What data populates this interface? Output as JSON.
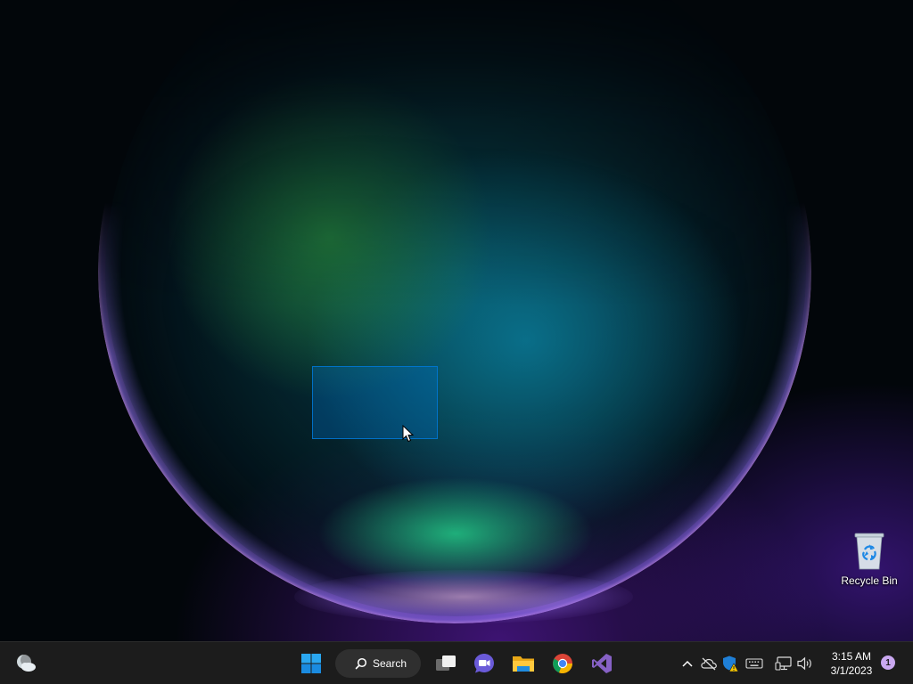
{
  "desktop": {
    "icons": [
      {
        "label": "Recycle Bin",
        "icon": "recycle-bin-icon"
      }
    ]
  },
  "taskbar": {
    "widgets": {
      "icon": "weather-cloud-moon-icon"
    },
    "start": {
      "icon": "windows-start-icon"
    },
    "search": {
      "label": "Search",
      "icon": "search-icon"
    },
    "pinned_apps": [
      {
        "name": "Task View",
        "icon": "task-view-icon"
      },
      {
        "name": "Chat",
        "icon": "chat-icon"
      },
      {
        "name": "File Explorer",
        "icon": "folder-icon"
      },
      {
        "name": "Google Chrome",
        "icon": "chrome-icon"
      },
      {
        "name": "Visual Studio",
        "icon": "visual-studio-icon"
      }
    ],
    "tray": [
      {
        "name": "show-hidden-icons",
        "icon": "chevron-up-icon"
      },
      {
        "name": "onedrive",
        "icon": "cloud-offline-icon"
      },
      {
        "name": "windows-security",
        "icon": "shield-warning-icon"
      },
      {
        "name": "keyboard",
        "icon": "keyboard-icon"
      },
      {
        "name": "network",
        "icon": "network-icon"
      },
      {
        "name": "volume",
        "icon": "speaker-icon"
      }
    ],
    "clock": {
      "time": "3:15 AM",
      "date": "3/1/2023"
    },
    "notifications": {
      "count": "1"
    }
  },
  "colors": {
    "taskbar_bg": "#1c1c1c",
    "selection": "#0078d7",
    "notification_badge": "#c9a8f0"
  }
}
